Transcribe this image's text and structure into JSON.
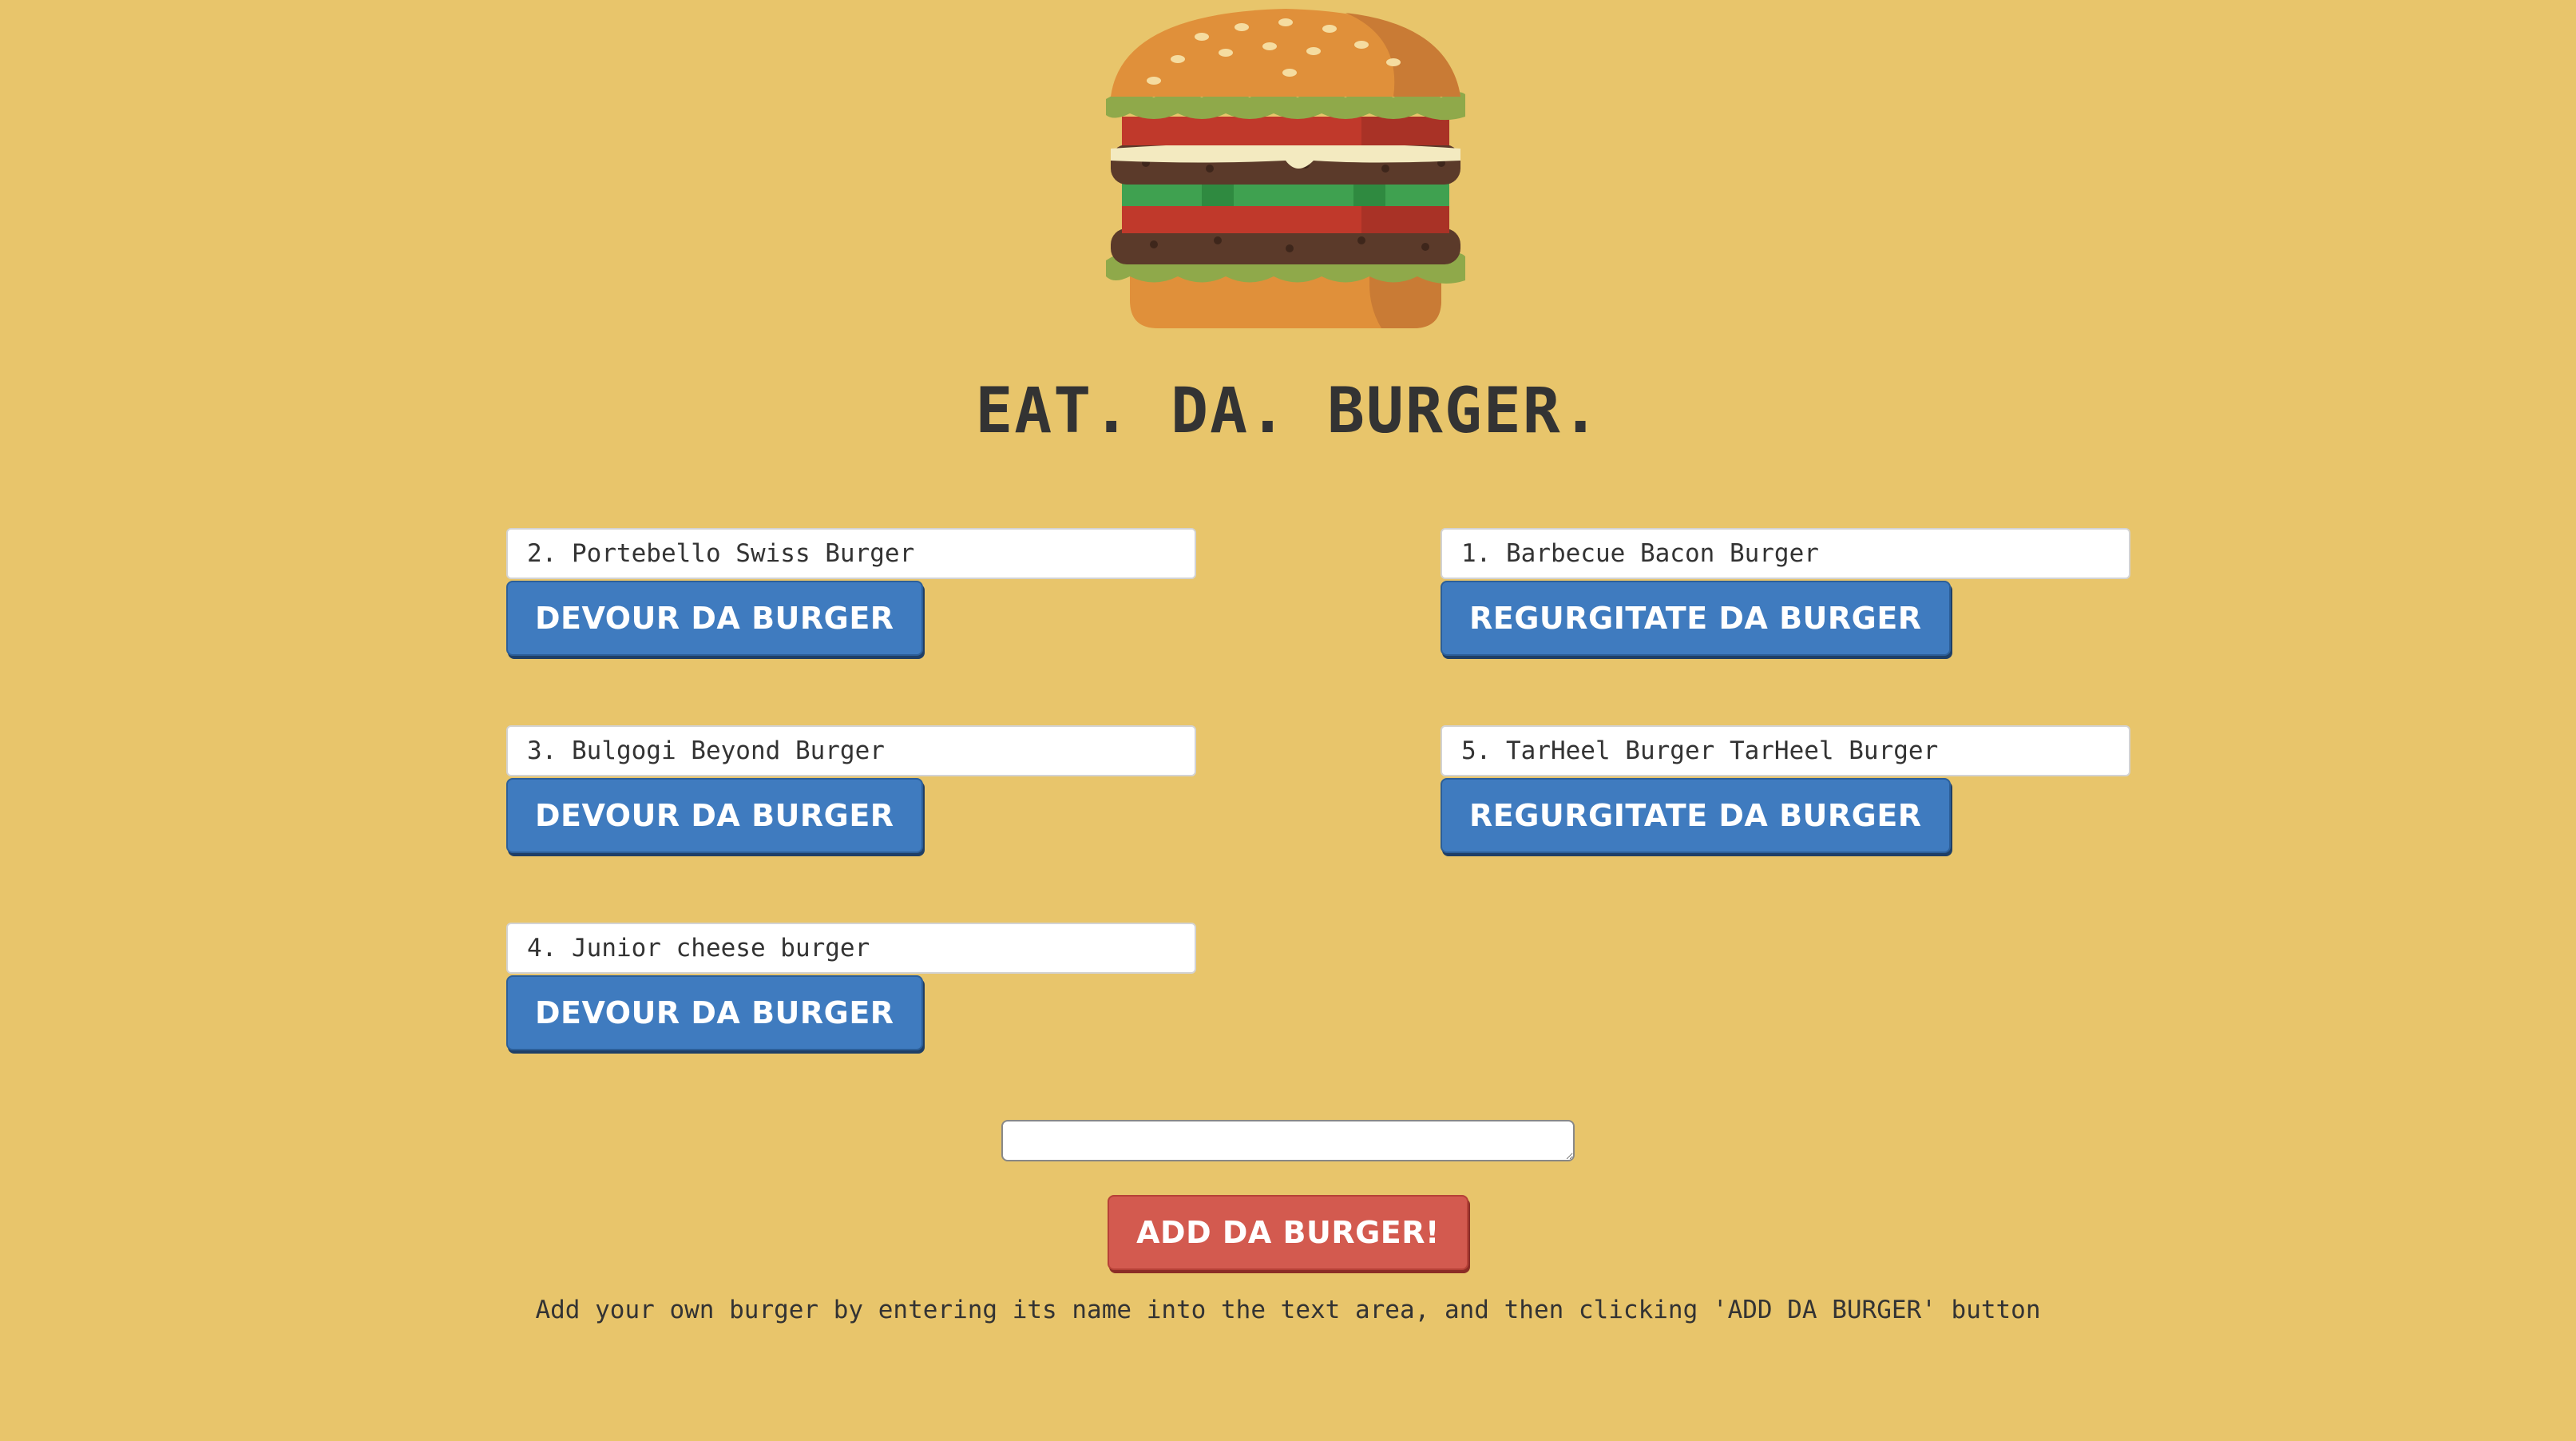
{
  "header": {
    "logo_icon": "burger-icon",
    "title": "EAT. DA. BURGER."
  },
  "not_devoured": [
    {
      "name": "2. Portebello Swiss Burger",
      "button_label": "DEVOUR DA BURGER"
    },
    {
      "name": "3. Bulgogi Beyond Burger",
      "button_label": "DEVOUR DA BURGER"
    },
    {
      "name": "4. Junior cheese burger",
      "button_label": "DEVOUR DA BURGER"
    }
  ],
  "devoured": [
    {
      "name": "1. Barbecue Bacon Burger",
      "button_label": "REGURGITATE DA BURGER"
    },
    {
      "name": "5. TarHeel Burger TarHeel Burger",
      "button_label": "REGURGITATE DA BURGER"
    }
  ],
  "form": {
    "input_value": "",
    "add_button_label": "ADD DA BURGER!",
    "help_text": "Add your own burger by entering its name into the text area, and then clicking 'ADD DA BURGER' button"
  },
  "colors": {
    "background": "#e8c56b",
    "button_blue": "#3f7bbf",
    "button_red": "#d35a4f"
  }
}
